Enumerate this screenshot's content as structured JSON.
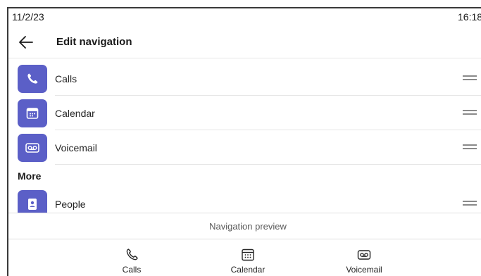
{
  "status_bar": {
    "date": "11/2/23",
    "time": "16:18"
  },
  "header": {
    "title": "Edit navigation",
    "back_icon": "arrow-left-icon"
  },
  "nav_items": [
    {
      "label": "Calls",
      "icon": "phone-icon"
    },
    {
      "label": "Calendar",
      "icon": "calendar-icon"
    },
    {
      "label": "Voicemail",
      "icon": "voicemail-icon"
    }
  ],
  "more_section": {
    "label": "More",
    "items": [
      {
        "label": "People",
        "icon": "contact-book-icon"
      }
    ]
  },
  "preview": {
    "label": "Navigation preview",
    "tabs": [
      {
        "label": "Calls",
        "icon": "phone-icon"
      },
      {
        "label": "Calendar",
        "icon": "calendar-icon"
      },
      {
        "label": "Voicemail",
        "icon": "voicemail-icon"
      }
    ]
  },
  "colors": {
    "accent": "#5b5fc7",
    "text": "#242424",
    "divider": "#e6e6e6"
  }
}
